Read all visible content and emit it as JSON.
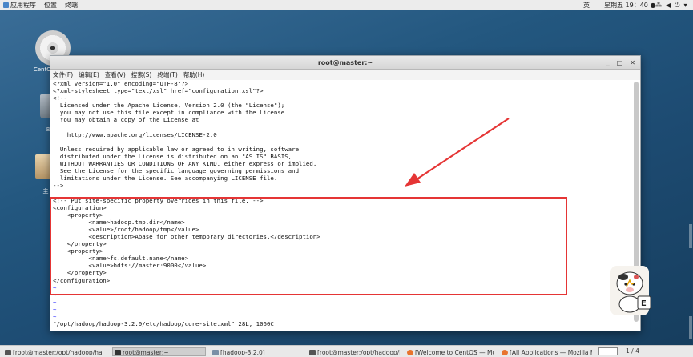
{
  "topbar": {
    "applications": "应用程序",
    "places": "位置",
    "terminal": "终端",
    "lang": "英",
    "clock": "星期五 19：40 ●"
  },
  "desktop": {
    "disc_label": "CentOS",
    "trash_label": "回",
    "folder_label": "主"
  },
  "terminal": {
    "title": "root@master:~",
    "menu": [
      "文件(F)",
      "编辑(E)",
      "查看(V)",
      "搜索(S)",
      "终端(T)",
      "帮助(H)"
    ],
    "lines": [
      "<?xml version=\"1.0\" encoding=\"UTF-8\"?>",
      "<?xml-stylesheet type=\"text/xsl\" href=\"configuration.xsl\"?>",
      "<!--",
      "  Licensed under the Apache License, Version 2.0 (the \"License\");",
      "  you may not use this file except in compliance with the License.",
      "  You may obtain a copy of the License at",
      "",
      "    http://www.apache.org/licenses/LICENSE-2.0",
      "",
      "  Unless required by applicable law or agreed to in writing, software",
      "  distributed under the License is distributed on an \"AS IS\" BASIS,",
      "  WITHOUT WARRANTIES OR CONDITIONS OF ANY KIND, either express or implied.",
      "  See the License for the specific language governing permissions and",
      "  limitations under the License. See accompanying LICENSE file.",
      "-->",
      "",
      "<!-- Put site-specific property overrides in this file. -->",
      "<configuration>",
      "    <property>",
      "          <name>hadoop.tmp.dir</name>",
      "          <value>/root/hadoop/tmp</value>",
      "          <description>Abase for other temporary directories.</description>",
      "    </property>",
      "    <property>",
      "          <name>fs.default.name</name>",
      "          <value>hdfs://master:9000</value>",
      "    </property>",
      "</configuration>",
      "~",
      "~",
      "~",
      "~",
      "~"
    ],
    "status_line": "\"/opt/hadoop/hadoop-3.2.0/etc/hadoop/core-site.xml\" 28L, 1060C"
  },
  "taskbar": {
    "items": [
      "[root@master:/opt/hadoop/ha-...",
      "root@master:~",
      "[hadoop-3.2.0]",
      "[root@master:/opt/hadoop/ha-...",
      "[Welcome to CentOS — Mozill...",
      "[All Applications — Mozilla Fire..."
    ],
    "workspace": "1 / 4"
  },
  "colors": {
    "highlight": "#e53535",
    "desktop_bg": "#23577f",
    "tilde": "#3a3aff"
  }
}
